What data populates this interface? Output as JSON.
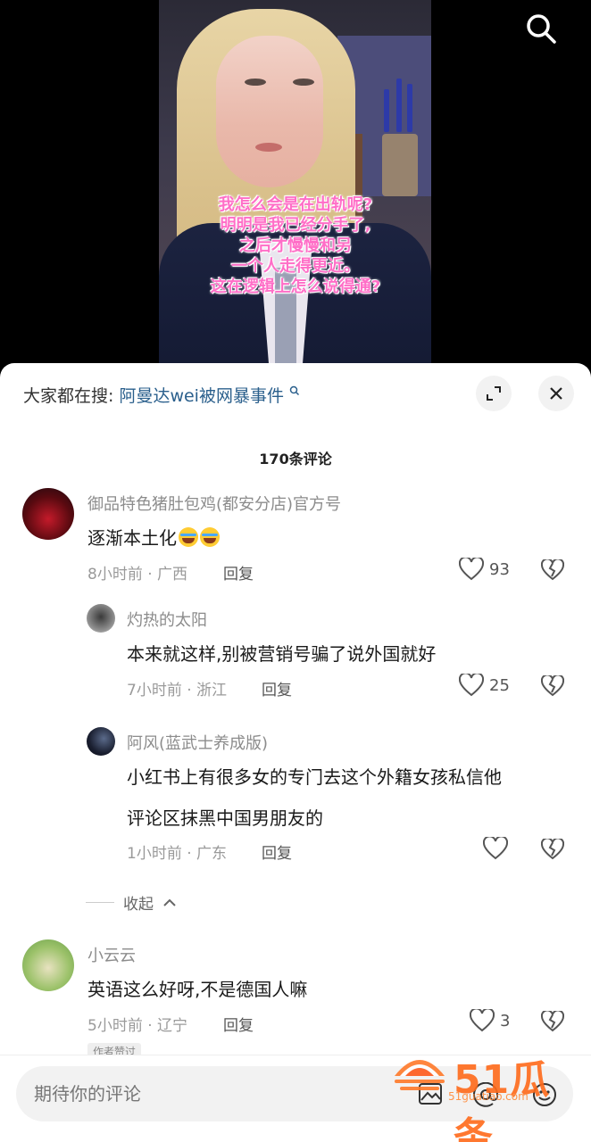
{
  "video": {
    "caption_lines": [
      "我怎么会是在出轨呢?",
      "明明是我已经分手了,",
      "之后才慢慢和另",
      "一个人走得更近。",
      "这在逻辑上怎么说得通?"
    ]
  },
  "hot_search": {
    "prefix": "大家都在搜:",
    "link": "阿曼达wei被网暴事件"
  },
  "comment_count": "170条评论",
  "comments": [
    {
      "name": "御品特色猪肚包鸡(都安分店)官方号",
      "text": "逐渐本土化",
      "time": "8小时前 · 广西",
      "reply": "回复",
      "likes": "93"
    },
    {
      "name": "灼热的太阳",
      "text": "本来就这样,别被营销号骗了说外国就好",
      "time": "7小时前 · 浙江",
      "reply": "回复",
      "likes": "25"
    },
    {
      "name": "阿风(蓝武士养成版)",
      "text_line1": "小红书上有很多女的专门去这个外籍女孩私信他",
      "text_line2": "评论区抹黑中国男朋友的",
      "time": "1小时前 · 广东",
      "reply": "回复",
      "likes": ""
    },
    {
      "name": "小云云",
      "text": "英语这么好呀,不是德国人嘛",
      "time": "5小时前 · 辽宁",
      "reply": "回复",
      "likes": "3"
    }
  ],
  "collapse_label": "收起",
  "author_tag": "作者赞过",
  "input": {
    "placeholder": "期待你的评论"
  },
  "watermark": {
    "text": "51瓜条",
    "url": "51guatiao.com"
  },
  "colors": {
    "link": "#2a5f8c",
    "caption": "#ff6ec7",
    "watermark": "#ff6a1a"
  }
}
